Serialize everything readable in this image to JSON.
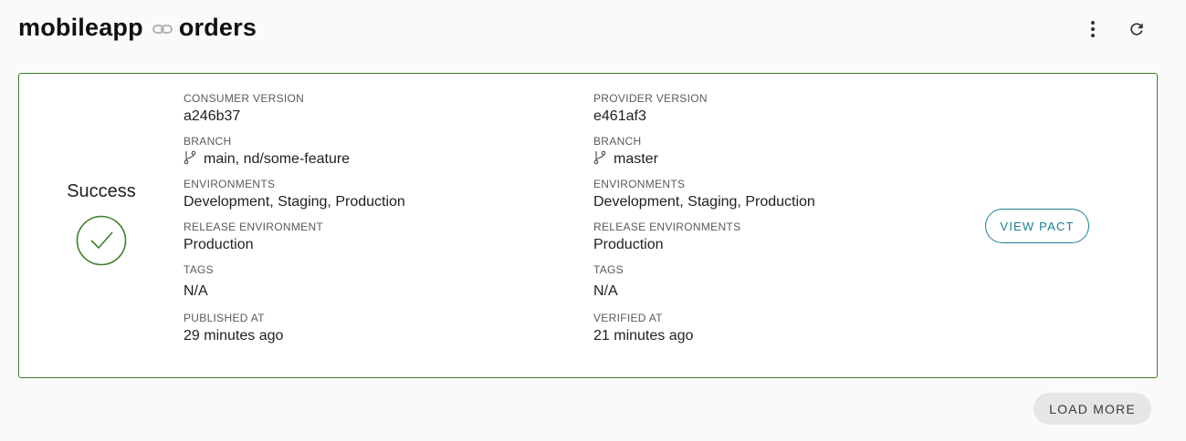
{
  "header": {
    "consumer": "mobileapp",
    "provider": "orders",
    "link_icon": "link-icon",
    "actions": [
      "more-vert-icon",
      "refresh-icon"
    ]
  },
  "card": {
    "status": "Success",
    "status_icon": "check-circle-icon",
    "border_color": "#3f7f2a",
    "consumer": {
      "version_label": "CONSUMER VERSION",
      "version": "a246b37",
      "branch_label": "BRANCH",
      "branch": "main, nd/some-feature",
      "environments_label": "ENVIRONMENTS",
      "environments": "Development, Staging, Production",
      "release_label": "RELEASE ENVIRONMENT",
      "release": "Production",
      "tags_label": "TAGS",
      "tags": "N/A",
      "time_label": "PUBLISHED AT",
      "time": "29 minutes ago"
    },
    "provider": {
      "version_label": "PROVIDER VERSION",
      "version": "e461af3",
      "branch_label": "BRANCH",
      "branch": "master",
      "environments_label": "ENVIRONMENTS",
      "environments": "Development, Staging, Production",
      "release_label": "RELEASE ENVIRONMENTS",
      "release": "Production",
      "tags_label": "TAGS",
      "tags": "N/A",
      "time_label": "VERIFIED AT",
      "time": "21 minutes ago"
    },
    "view_pact_label": "VIEW PACT",
    "accent_color": "#1a7f8e"
  },
  "footer": {
    "load_more_label": "LOAD MORE"
  }
}
